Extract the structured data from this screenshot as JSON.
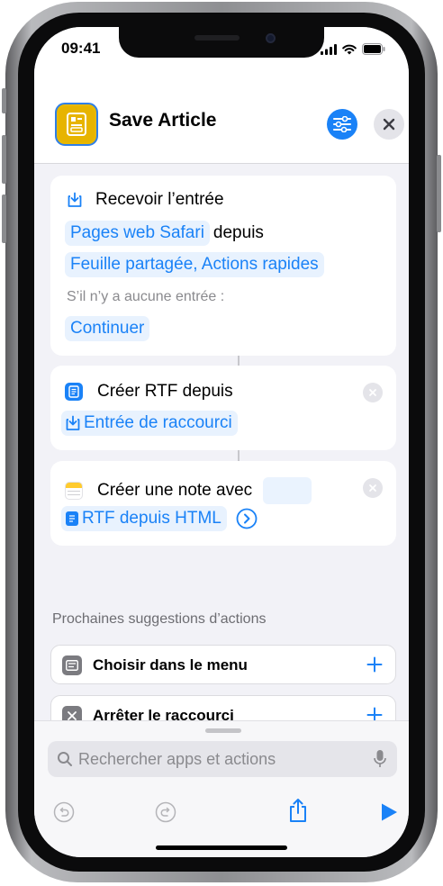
{
  "status": {
    "time": "09:41"
  },
  "header": {
    "title": "Save Article",
    "app_icon": "document-icon",
    "accent": "#1a82f7",
    "app_icon_color": "#e9b800"
  },
  "actions": [
    {
      "title": "Recevoir l’entrée",
      "icon": "receive-input-icon",
      "input_token": "Pages web Safari",
      "connector": "depuis",
      "source_token": "Feuille partagée, Actions rapides",
      "fallback_label": "S’il n’y a aucune entrée :",
      "fallback_token": "Continuer"
    },
    {
      "title": "Créer RTF depuis",
      "icon": "rtf-document-icon",
      "token": "Entrée de raccourci"
    },
    {
      "title": "Créer une note avec",
      "icon": "notes-icon",
      "token": "RTF depuis HTML"
    }
  ],
  "suggestions": {
    "title": "Prochaines suggestions d’actions",
    "items": [
      {
        "label": "Choisir dans le menu",
        "icon": "menu-icon"
      },
      {
        "label": "Arrêter le raccourci",
        "icon": "stop-icon"
      }
    ]
  },
  "search": {
    "placeholder": "Rechercher apps et actions",
    "value": ""
  },
  "toolbar": {
    "undo": "undo-icon",
    "redo": "redo-icon",
    "share": "share-icon",
    "run": "play-icon"
  }
}
